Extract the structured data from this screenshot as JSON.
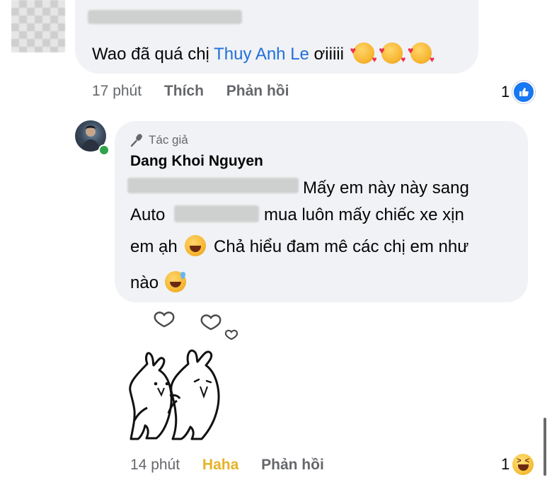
{
  "top_comment": {
    "text_before": "Wao đã quá chị ",
    "mention": "Thuy Anh Le",
    "text_after": " ơiiiii",
    "emojis": [
      "smiling-face-with-hearts-icon",
      "smiling-face-with-hearts-icon",
      "smiling-face-with-hearts-icon"
    ],
    "time": "17 phút",
    "like_label": "Thích",
    "reply_label": "Phản hồi",
    "reaction_count": "1",
    "reaction_icon": "like-icon"
  },
  "reply_comment": {
    "badge_label": "Tác giả",
    "badge_icon": "microphone-icon",
    "author": "Dang Khoi Nguyen",
    "lines": [
      "Mấy em này này sang",
      "Auto",
      "mua luôn mấy chiếc xe xịn",
      "em ạh",
      "Chả hiểu đam mê các chị em như",
      "nào"
    ],
    "time": "14 phút",
    "reaction_label": "Haha",
    "reply_label": "Phản hồi",
    "reaction_count": "1",
    "reaction_icon": "haha-icon"
  },
  "colors": {
    "bubble": "#f0f2f5",
    "mention": "#216fdb",
    "secondary_text": "#65676b",
    "haha": "#e6b227",
    "like": "#1877f2",
    "online": "#31a24c"
  }
}
